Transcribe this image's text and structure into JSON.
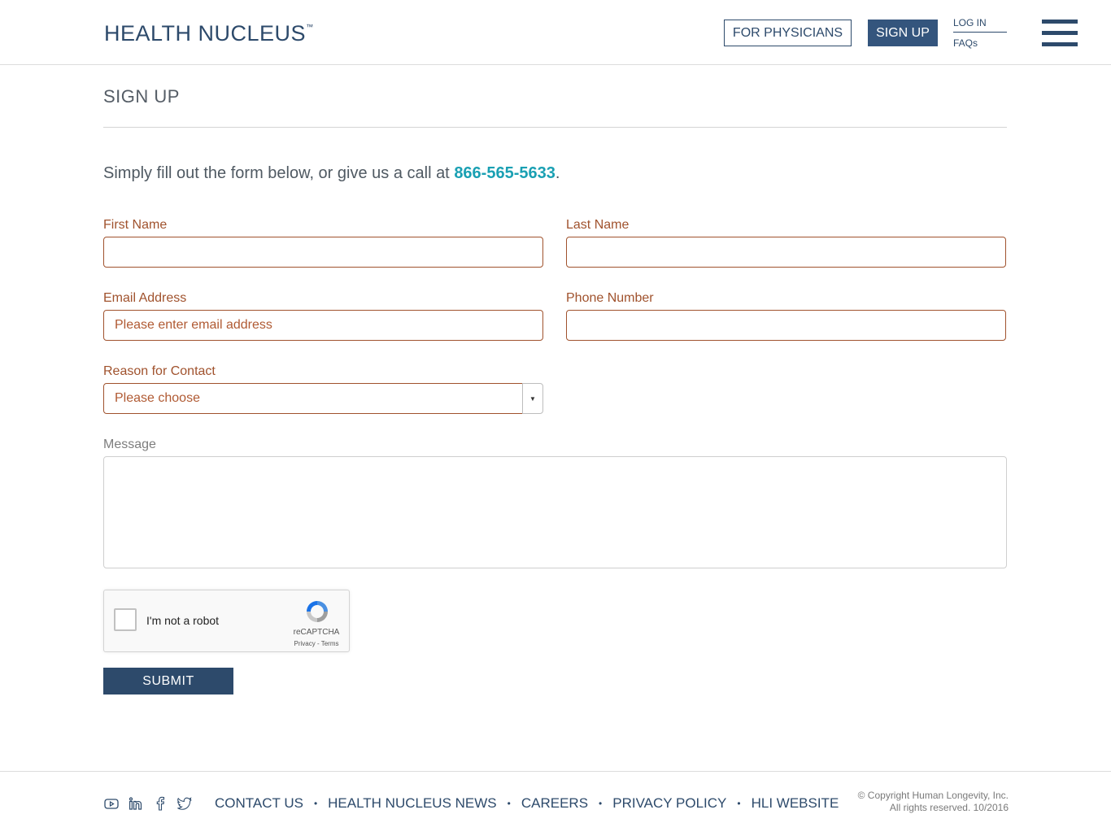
{
  "header": {
    "logo": "HEALTH NUCLEUS",
    "logo_tm": "™",
    "for_physicians": "FOR PHYSICIANS",
    "sign_up": "SIGN UP",
    "log_in": "LOG IN",
    "faqs": "FAQs"
  },
  "page": {
    "title": "SIGN UP",
    "intro_text": "Simply fill out the form below, or give us a call at ",
    "intro_phone": "866-565-5633",
    "intro_end": "."
  },
  "form": {
    "first_name_label": "First Name",
    "first_name_value": "",
    "last_name_label": "Last Name",
    "last_name_value": "",
    "email_label": "Email Address",
    "email_placeholder": "Please enter email address",
    "phone_label": "Phone Number",
    "phone_value": "",
    "reason_label": "Reason for Contact",
    "reason_selected": "Please choose",
    "message_label": "Message",
    "message_value": "",
    "captcha_text": "I'm not a robot",
    "captcha_brand": "reCAPTCHA",
    "captcha_terms": "Privacy - Terms",
    "submit_label": "SUBMIT"
  },
  "footer": {
    "links": [
      "CONTACT US",
      "HEALTH NUCLEUS NEWS",
      "CAREERS",
      "PRIVACY POLICY",
      "HLI WEBSITE"
    ],
    "separator": "•",
    "copyright_line1": "© Copyright Human Longevity, Inc.",
    "copyright_line2": "All rights reserved. 10/2016",
    "social_icons": [
      "youtube-icon",
      "linkedin-icon",
      "facebook-icon",
      "twitter-icon"
    ]
  },
  "colors": {
    "brand_navy": "#2d4a6b",
    "field_accent": "#a0522d",
    "phone_teal": "#1aa0b3"
  }
}
